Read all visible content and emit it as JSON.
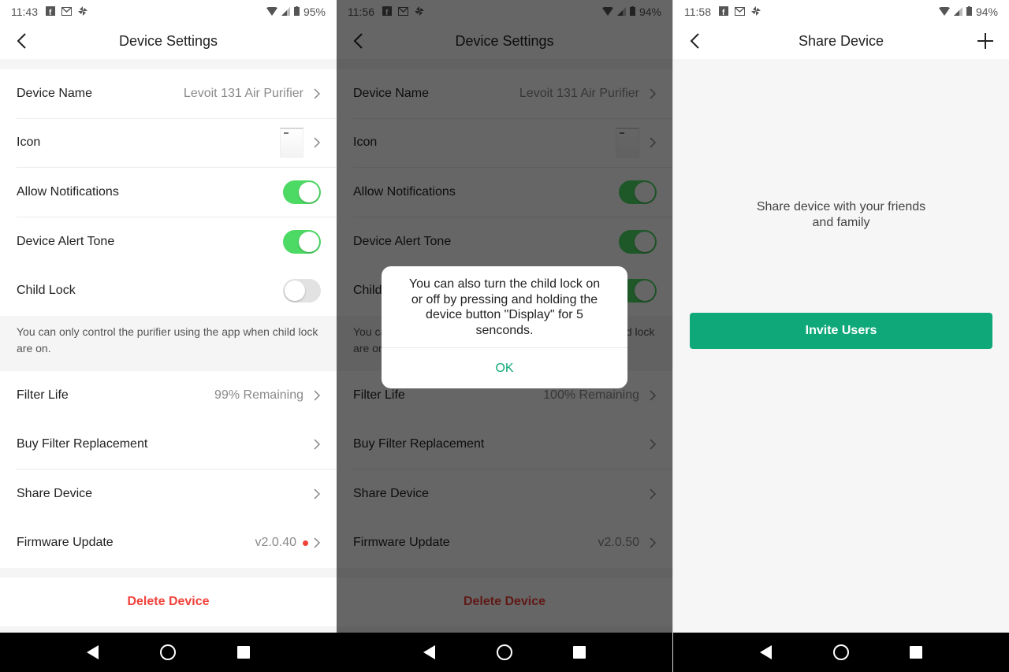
{
  "screens": [
    {
      "status": {
        "time": "11:43",
        "battery": "95%"
      },
      "header": {
        "title": "Device Settings"
      },
      "rows": {
        "device_name": {
          "label": "Device Name",
          "value": "Levoit 131 Air Purifier"
        },
        "icon": {
          "label": "Icon"
        },
        "allow_notifications": {
          "label": "Allow Notifications",
          "state": "on"
        },
        "alert_tone": {
          "label": "Device Alert Tone",
          "state": "on"
        },
        "child_lock": {
          "label": "Child Lock",
          "state": "off"
        },
        "child_lock_hint": "You can only control the purifier using the app when child lock are on.",
        "filter_life": {
          "label": "Filter Life",
          "value": "99% Remaining"
        },
        "buy_filter": {
          "label": "Buy Filter Replacement"
        },
        "share_device": {
          "label": "Share Device"
        },
        "firmware": {
          "label": "Firmware Update",
          "value": "v2.0.40",
          "update_badge": true
        }
      },
      "delete_label": "Delete Device"
    },
    {
      "status": {
        "time": "11:56",
        "battery": "94%"
      },
      "header": {
        "title": "Device Settings"
      },
      "rows": {
        "device_name": {
          "label": "Device Name",
          "value": "Levoit 131 Air Purifier"
        },
        "icon": {
          "label": "Icon"
        },
        "allow_notifications": {
          "label": "Allow Notifications",
          "state": "on"
        },
        "alert_tone": {
          "label": "Device Alert Tone",
          "state": "on"
        },
        "child_lock": {
          "label": "Child Lock",
          "state": "on"
        },
        "child_lock_hint": "You can only control the purifier using the app when child lock are on.",
        "filter_life": {
          "label": "Filter Life",
          "value": "100% Remaining"
        },
        "buy_filter": {
          "label": "Buy Filter Replacement"
        },
        "share_device": {
          "label": "Share Device"
        },
        "firmware": {
          "label": "Firmware Update",
          "value": "v2.0.50",
          "update_badge": false
        }
      },
      "delete_label": "Delete Device",
      "dialog": {
        "message": "You can also turn the child lock on or off by pressing and holding the device button \"Display\" for 5 senconds.",
        "ok_label": "OK"
      }
    },
    {
      "status": {
        "time": "11:58",
        "battery": "94%"
      },
      "header": {
        "title": "Share Device"
      },
      "share_text": "Share device with your friends and family",
      "invite_label": "Invite Users"
    }
  ],
  "colors": {
    "toggle_on": "#4cd964",
    "delete_red": "#f0433b",
    "accent_green": "#0fa878"
  }
}
